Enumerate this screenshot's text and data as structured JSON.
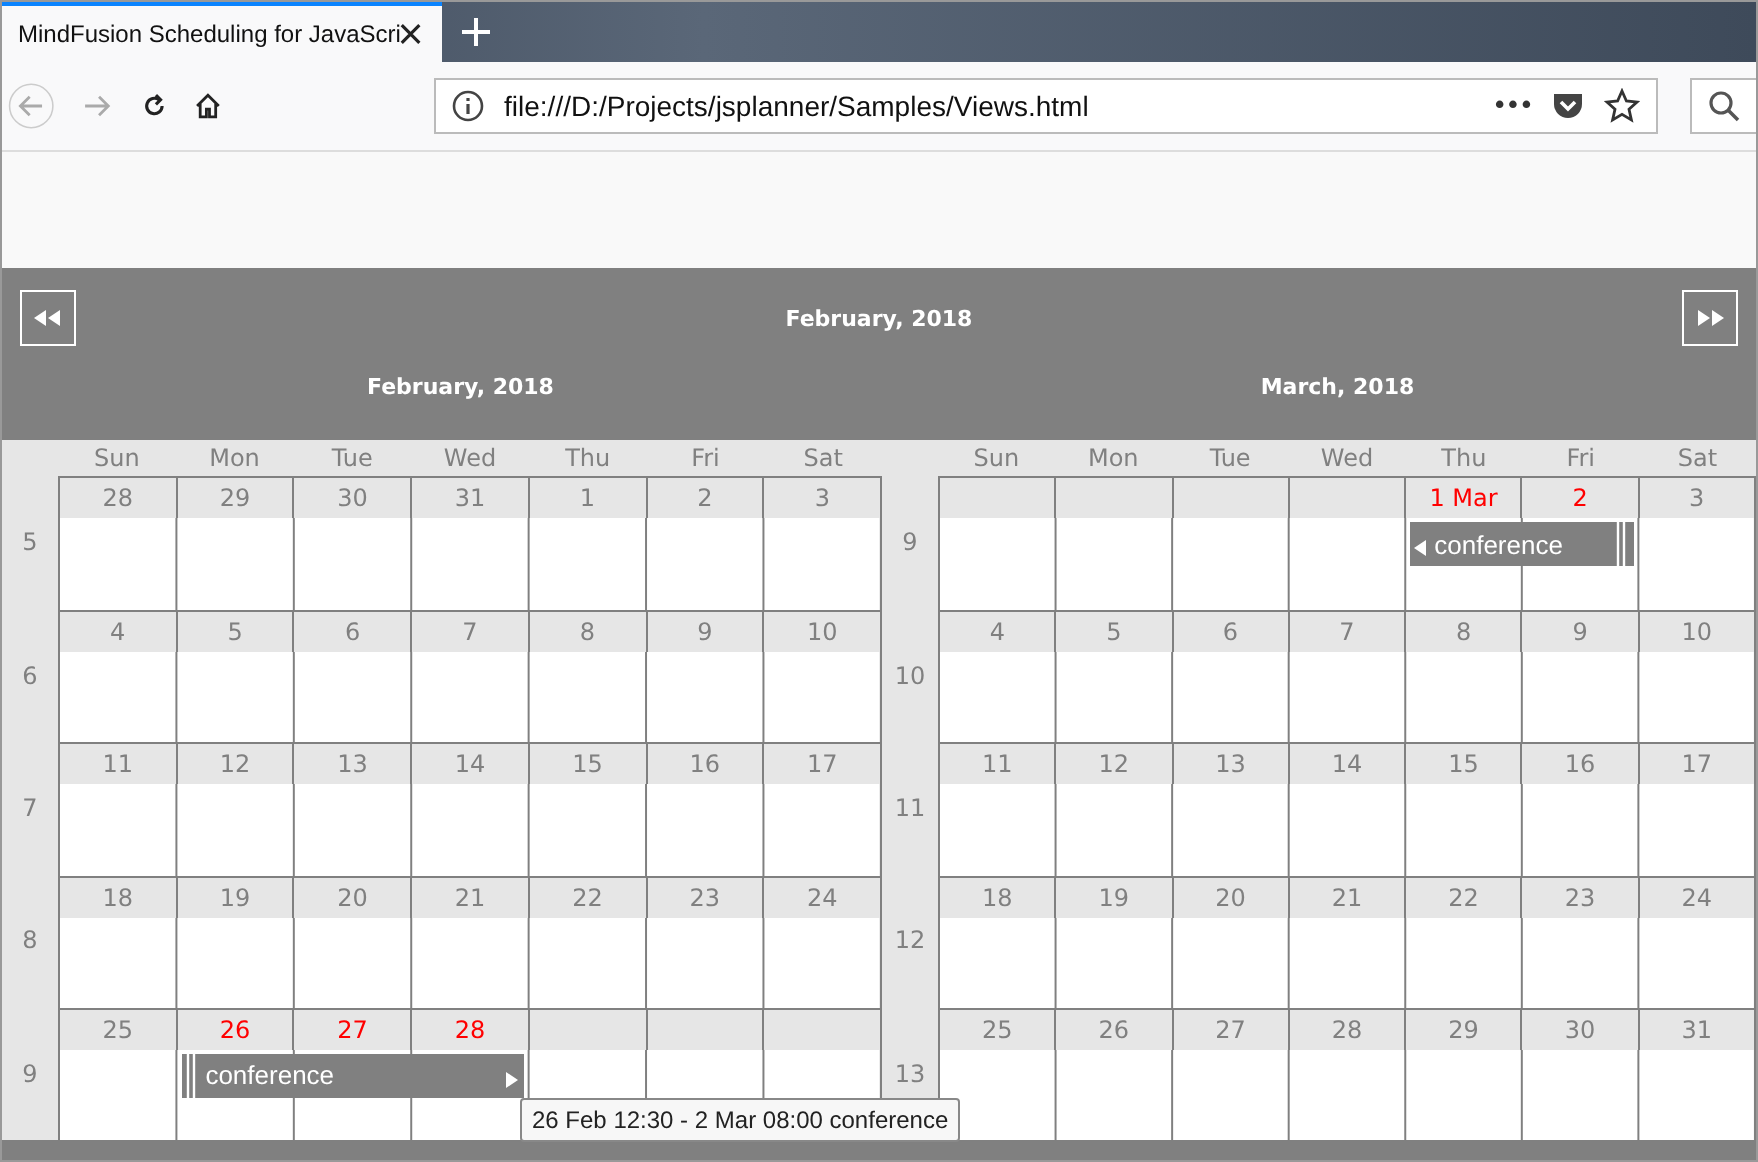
{
  "browser": {
    "tab_title": "MindFusion Scheduling for JavaScri",
    "url": "file:///D:/Projects/jsplanner/Samples/Views.html",
    "menu_dots": "•••"
  },
  "calendar": {
    "title": "February, 2018",
    "months": [
      {
        "title": "February, 2018",
        "day_names": [
          "Sun",
          "Mon",
          "Tue",
          "Wed",
          "Thu",
          "Fri",
          "Sat"
        ],
        "weeks": [
          {
            "number": "5",
            "days": [
              {
                "kind": "date",
                "label": "28",
                "in_event": false
              },
              {
                "kind": "date",
                "label": "29",
                "in_event": false
              },
              {
                "kind": "date",
                "label": "30",
                "in_event": false
              },
              {
                "kind": "date",
                "label": "31",
                "in_event": false
              },
              {
                "kind": "date",
                "label": "1",
                "in_event": false
              },
              {
                "kind": "date",
                "label": "2",
                "in_event": false
              },
              {
                "kind": "date",
                "label": "3",
                "in_event": false
              }
            ]
          },
          {
            "number": "6",
            "days": [
              {
                "kind": "date",
                "label": "4",
                "in_event": false
              },
              {
                "kind": "date",
                "label": "5",
                "in_event": false
              },
              {
                "kind": "date",
                "label": "6",
                "in_event": false
              },
              {
                "kind": "date",
                "label": "7",
                "in_event": false
              },
              {
                "kind": "date",
                "label": "8",
                "in_event": false
              },
              {
                "kind": "date",
                "label": "9",
                "in_event": false
              },
              {
                "kind": "date",
                "label": "10",
                "in_event": false
              }
            ]
          },
          {
            "number": "7",
            "days": [
              {
                "kind": "date",
                "label": "11",
                "in_event": false
              },
              {
                "kind": "date",
                "label": "12",
                "in_event": false
              },
              {
                "kind": "date",
                "label": "13",
                "in_event": false
              },
              {
                "kind": "date",
                "label": "14",
                "in_event": false
              },
              {
                "kind": "date",
                "label": "15",
                "in_event": false
              },
              {
                "kind": "date",
                "label": "16",
                "in_event": false
              },
              {
                "kind": "date",
                "label": "17",
                "in_event": false
              }
            ]
          },
          {
            "number": "8",
            "days": [
              {
                "kind": "date",
                "label": "18",
                "in_event": false
              },
              {
                "kind": "date",
                "label": "19",
                "in_event": false
              },
              {
                "kind": "date",
                "label": "20",
                "in_event": false
              },
              {
                "kind": "date",
                "label": "21",
                "in_event": false
              },
              {
                "kind": "date",
                "label": "22",
                "in_event": false
              },
              {
                "kind": "date",
                "label": "23",
                "in_event": false
              },
              {
                "kind": "date",
                "label": "24",
                "in_event": false
              }
            ]
          },
          {
            "number": "9",
            "days": [
              {
                "kind": "date",
                "label": "25",
                "in_event": false
              },
              {
                "kind": "date",
                "label": "26",
                "in_event": true
              },
              {
                "kind": "date",
                "label": "27",
                "in_event": true
              },
              {
                "kind": "date",
                "label": "28",
                "in_event": true
              },
              {
                "kind": "blank"
              },
              {
                "kind": "blank"
              },
              {
                "kind": "blank"
              }
            ],
            "event": {
              "title": "conference",
              "continues_before": false,
              "continues_after": true
            }
          }
        ]
      },
      {
        "title": "March, 2018",
        "day_names": [
          "Sun",
          "Mon",
          "Tue",
          "Wed",
          "Thu",
          "Fri",
          "Sat"
        ],
        "weeks": [
          {
            "number": "9",
            "days": [
              {
                "kind": "blank"
              },
              {
                "kind": "blank"
              },
              {
                "kind": "blank"
              },
              {
                "kind": "blank"
              },
              {
                "kind": "date",
                "label": "1 Mar",
                "in_event": true
              },
              {
                "kind": "date",
                "label": "2",
                "in_event": true
              },
              {
                "kind": "date",
                "label": "3",
                "in_event": false
              }
            ],
            "event": {
              "title": "conference",
              "continues_before": true,
              "continues_after": false
            }
          },
          {
            "number": "10",
            "days": [
              {
                "kind": "date",
                "label": "4",
                "in_event": false
              },
              {
                "kind": "date",
                "label": "5",
                "in_event": false
              },
              {
                "kind": "date",
                "label": "6",
                "in_event": false
              },
              {
                "kind": "date",
                "label": "7",
                "in_event": false
              },
              {
                "kind": "date",
                "label": "8",
                "in_event": false
              },
              {
                "kind": "date",
                "label": "9",
                "in_event": false
              },
              {
                "kind": "date",
                "label": "10",
                "in_event": false
              }
            ]
          },
          {
            "number": "11",
            "days": [
              {
                "kind": "date",
                "label": "11",
                "in_event": false
              },
              {
                "kind": "date",
                "label": "12",
                "in_event": false
              },
              {
                "kind": "date",
                "label": "13",
                "in_event": false
              },
              {
                "kind": "date",
                "label": "14",
                "in_event": false
              },
              {
                "kind": "date",
                "label": "15",
                "in_event": false
              },
              {
                "kind": "date",
                "label": "16",
                "in_event": false
              },
              {
                "kind": "date",
                "label": "17",
                "in_event": false
              }
            ]
          },
          {
            "number": "12",
            "days": [
              {
                "kind": "date",
                "label": "18",
                "in_event": false
              },
              {
                "kind": "date",
                "label": "19",
                "in_event": false
              },
              {
                "kind": "date",
                "label": "20",
                "in_event": false
              },
              {
                "kind": "date",
                "label": "21",
                "in_event": false
              },
              {
                "kind": "date",
                "label": "22",
                "in_event": false
              },
              {
                "kind": "date",
                "label": "23",
                "in_event": false
              },
              {
                "kind": "date",
                "label": "24",
                "in_event": false
              }
            ]
          },
          {
            "number": "13",
            "days": [
              {
                "kind": "date",
                "label": "25",
                "in_event": false
              },
              {
                "kind": "date",
                "label": "26",
                "in_event": false
              },
              {
                "kind": "date",
                "label": "27",
                "in_event": false
              },
              {
                "kind": "date",
                "label": "28",
                "in_event": false
              },
              {
                "kind": "date",
                "label": "29",
                "in_event": false
              },
              {
                "kind": "date",
                "label": "30",
                "in_event": false
              },
              {
                "kind": "date",
                "label": "31",
                "in_event": false
              }
            ]
          }
        ]
      }
    ],
    "tooltip": "26 Feb 12:30 - 2 Mar 08:00 conference"
  }
}
